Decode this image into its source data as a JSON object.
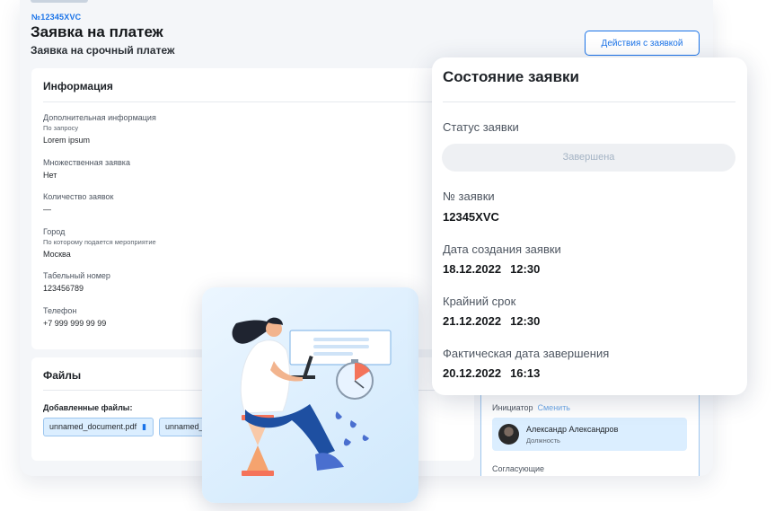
{
  "request": {
    "id": "№12345XVC",
    "title": "Заявка на платеж",
    "subtitle": "Заявка на срочный платеж",
    "actions_label": "Действия с заявкой"
  },
  "info": {
    "title": "Информация",
    "fields": [
      {
        "label": "Дополнительная информация",
        "hint": "По запросу",
        "value": "Lorem ipsum"
      },
      {
        "label": "Множественная заявка",
        "hint": "",
        "value": "Нет"
      },
      {
        "label": "Количество заявок",
        "hint": "",
        "value": "—"
      },
      {
        "label": "Город",
        "hint": "По которому подается мероприятие",
        "value": "Москва"
      },
      {
        "label": "Табельный номер",
        "hint": "",
        "value": "123456789"
      },
      {
        "label": "Телефон",
        "hint": "",
        "value": "+7 999 999 99 99"
      }
    ]
  },
  "files": {
    "title": "Файлы",
    "added_label": "Добавленные файлы:",
    "items": [
      "unnamed_document.pdf",
      "unnamed_document.pdf"
    ]
  },
  "side": {
    "initiator_label": "Инициатор",
    "change_label": "Сменить",
    "person_name": "Александр Александров",
    "person_role": "Должность",
    "approvers_label": "Согласующие"
  },
  "status": {
    "title": "Состояние заявки",
    "status_label": "Статус заявки",
    "status_value": "Завершена",
    "number_label": "№ заявки",
    "number_value": "12345XVC",
    "created_label": "Дата создания заявки",
    "created_date": "18.12.2022",
    "created_time": "12:30",
    "deadline_label": "Крайний срок",
    "deadline_date": "21.12.2022",
    "deadline_time": "12:30",
    "finished_label": "Фактическая дата завершения",
    "finished_date": "20.12.2022",
    "finished_time": "16:13"
  },
  "colors": {
    "accent": "#1a73e8",
    "chip_bg": "#dbeeff",
    "status_pill_bg": "#eef0f3",
    "status_pill_text": "#a4b3c4"
  },
  "icons": [
    "paperclip-icon",
    "avatar-photo",
    "illustration-woman-laptop",
    "hourglass-icon",
    "stopwatch-icon"
  ]
}
